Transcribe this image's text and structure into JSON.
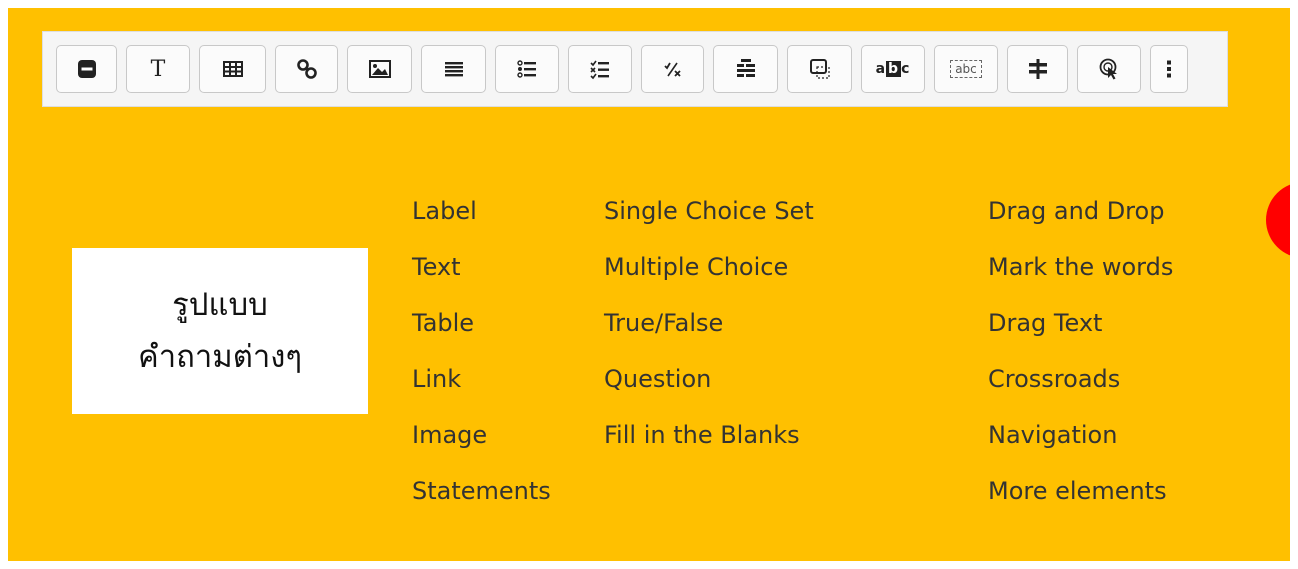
{
  "colors": {
    "background": "#ffc000",
    "accent": "#ff0000",
    "text": "#333333"
  },
  "toolbar": {
    "buttons": [
      {
        "name": "header-button",
        "icon": "minus-block-icon"
      },
      {
        "name": "text-button",
        "icon": "text-t-icon",
        "glyph": "T"
      },
      {
        "name": "table-button",
        "icon": "table-icon"
      },
      {
        "name": "link-button",
        "icon": "link-icon"
      },
      {
        "name": "image-button",
        "icon": "image-icon"
      },
      {
        "name": "statements-button",
        "icon": "list-icon"
      },
      {
        "name": "single-choice-button",
        "icon": "radio-list-icon"
      },
      {
        "name": "multiple-choice-button",
        "icon": "checkbox-list-icon"
      },
      {
        "name": "true-false-button",
        "icon": "true-false-icon"
      },
      {
        "name": "question-button",
        "icon": "question-set-icon"
      },
      {
        "name": "fill-blanks-button",
        "icon": "fill-blanks-icon"
      },
      {
        "name": "mark-words-button",
        "icon": "mark-words-icon",
        "glyph": "abc"
      },
      {
        "name": "drag-text-button",
        "icon": "drag-text-icon",
        "glyph": "abc"
      },
      {
        "name": "crossroads-button",
        "icon": "crossroads-icon"
      },
      {
        "name": "navigation-button",
        "icon": "hotspot-click-icon"
      },
      {
        "name": "more-elements-button",
        "icon": "more-vertical-icon"
      }
    ]
  },
  "textbox": {
    "line1": "รูปแบบ",
    "line2": "คำถามต่างๆ"
  },
  "lists": {
    "col1": [
      "Label",
      "Text",
      "Table",
      "Link",
      "Image",
      "Statements"
    ],
    "col2": [
      "Single Choice Set",
      "Multiple Choice",
      "True/False",
      "Question",
      "Fill in the Blanks"
    ],
    "col3": [
      "Drag and Drop",
      "Mark the words",
      "Drag Text",
      "Crossroads",
      "Navigation",
      "More elements"
    ]
  }
}
